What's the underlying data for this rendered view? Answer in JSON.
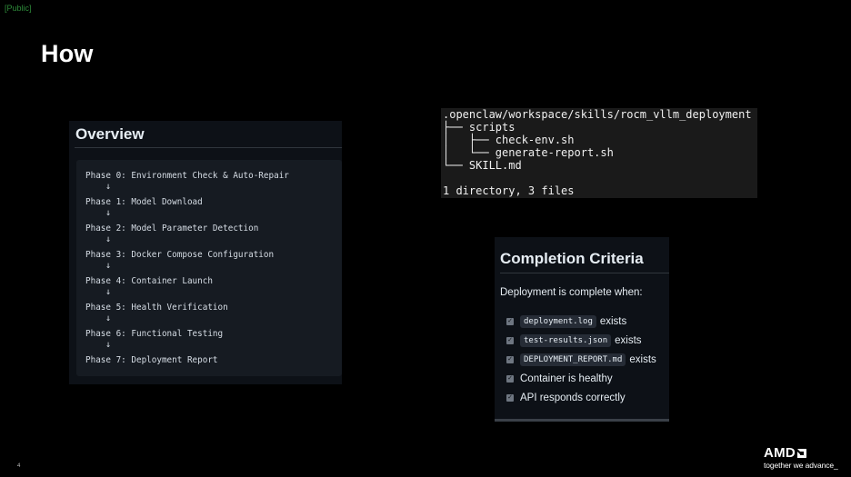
{
  "header": {
    "classification": "[Public]",
    "title": "How"
  },
  "overview": {
    "heading": "Overview",
    "phases": [
      "Phase 0: Environment Check & Auto-Repair",
      "Phase 1: Model Download",
      "Phase 2: Model Parameter Detection",
      "Phase 3: Docker Compose Configuration",
      "Phase 4: Container Launch",
      "Phase 5: Health Verification",
      "Phase 6: Functional Testing",
      "Phase 7: Deployment Report"
    ],
    "arrow": "↓"
  },
  "terminal": {
    "lines": [
      ".openclaw/workspace/skills/rocm_vllm_deployment",
      "├── scripts",
      "│   ├── check-env.sh",
      "│   └── generate-report.sh",
      "└── SKILL.md",
      "",
      "1 directory, 3 files"
    ]
  },
  "criteria": {
    "heading": "Completion Criteria",
    "intro": "Deployment is complete when:",
    "items": [
      {
        "code": "deployment.log",
        "text": "exists"
      },
      {
        "code": "test-results.json",
        "text": "exists"
      },
      {
        "code": "DEPLOYMENT_REPORT.md",
        "text": "exists"
      },
      {
        "code": "",
        "text": "Container is healthy"
      },
      {
        "code": "",
        "text": "API responds correctly"
      }
    ],
    "check_glyph": "✓"
  },
  "footer": {
    "page_number": "4",
    "brand": "AMD",
    "tagline": "together we advance_"
  }
}
